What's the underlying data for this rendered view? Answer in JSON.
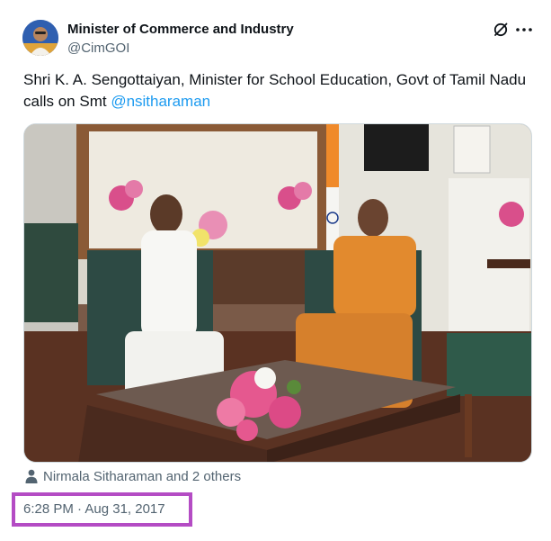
{
  "tweet": {
    "author_name": "Minister of Commerce and Industry",
    "author_handle": "@CimGOI",
    "text_prefix": "Shri K. A. Sengottaiyan, Minister for School Education, Govt of Tamil Nadu calls on Smt ",
    "mention": "@nsitharaman",
    "tagged_people": "Nirmala Sitharaman and 2 others",
    "timestamp": "6:28 PM · Aug 31, 2017"
  },
  "icons": {
    "grok": "grok-icon",
    "more": "more-icon",
    "person": "person-icon"
  },
  "colors": {
    "link": "#1d9bf0",
    "secondary_text": "#536471",
    "highlight_box": "#b44cc4"
  }
}
